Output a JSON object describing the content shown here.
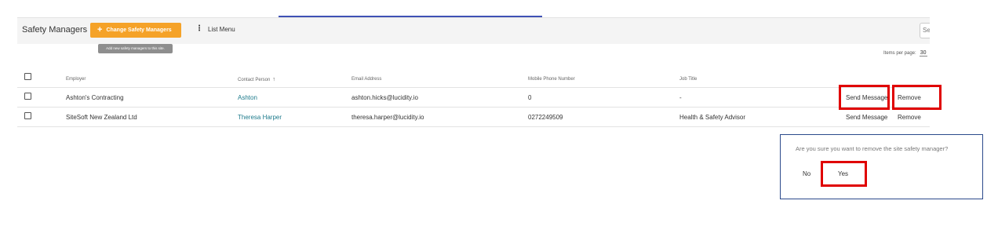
{
  "toolbar": {
    "title": "Safety Managers",
    "change_button_label": "Change Safety Managers",
    "change_button_icon": "plus-icon",
    "change_button_color": "#f5a228",
    "list_menu_label": "List Menu",
    "search_value": "Se"
  },
  "tooltip": "Add new safety managers to this site.",
  "pagination": {
    "items_per_page_label": "Items per page:",
    "items_per_page_value": "30"
  },
  "table": {
    "columns": [
      "Employer",
      "Contact Person",
      "Email Address",
      "Mobile Phone Number",
      "Job Title"
    ],
    "sort_icon": "arrow-up-icon",
    "rows": [
      {
        "employer": "Ashton's Contracting",
        "contact": "Ashton",
        "email": "ashton.hicks@lucidity.io",
        "mobile": "0",
        "job_title": "-",
        "send_label": "Send Message",
        "remove_label": "Remove"
      },
      {
        "employer": "SiteSoft New Zealand Ltd",
        "contact": "Theresa Harper",
        "email": "theresa.harper@lucidity.io",
        "mobile": "0272249509",
        "job_title": "Health & Safety Advisor",
        "send_label": "Send Message",
        "remove_label": "Remove"
      }
    ]
  },
  "dialog": {
    "message": "Are you sure you want to remove the site safety manager?",
    "no_label": "No",
    "yes_label": "Yes"
  },
  "colors": {
    "accent_line": "#3f51b5",
    "highlight": "#e00000",
    "link": "#1e7b8c",
    "dialog_border": "#2b4a8b"
  }
}
